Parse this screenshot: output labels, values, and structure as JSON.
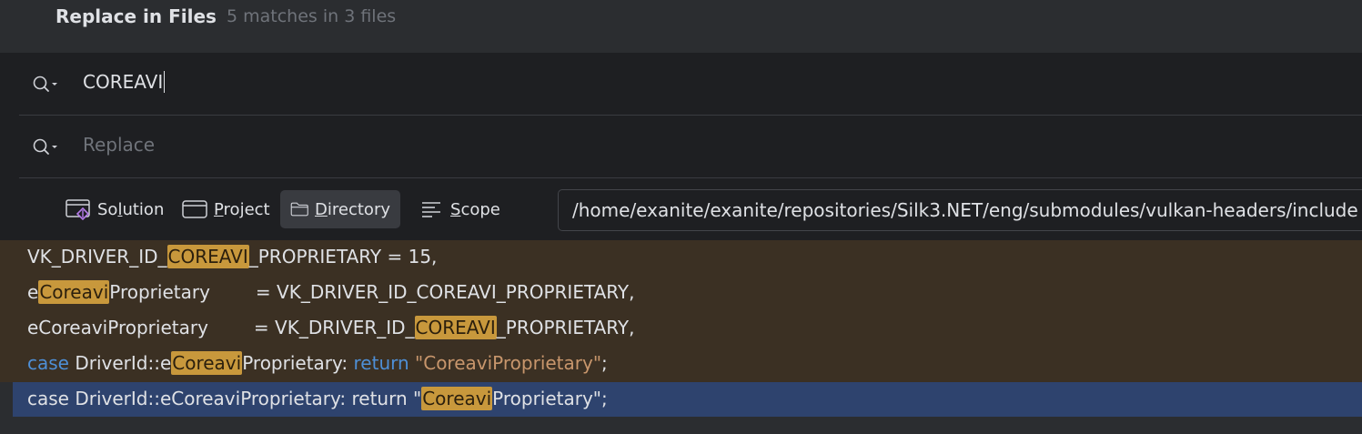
{
  "header": {
    "title": "Replace in Files",
    "match_summary": "5 matches in 3 files"
  },
  "find": {
    "value": "COREAVI"
  },
  "replace": {
    "placeholder": "Replace"
  },
  "scope_tabs": [
    {
      "label_pre": "So",
      "label_u": "l",
      "label_post": "ution",
      "icon": "solution-icon",
      "active": false
    },
    {
      "label_pre": "",
      "label_u": "P",
      "label_post": "roject",
      "icon": "project-icon",
      "active": false
    },
    {
      "label_pre": "",
      "label_u": "D",
      "label_post": "irectory",
      "icon": "folder-icon",
      "active": true
    },
    {
      "label_pre": "",
      "label_u": "S",
      "label_post": "cope",
      "icon": "scope-icon",
      "active": false
    }
  ],
  "directory_path": "/home/exanite/exanite/repositories/Silk3.NET/eng/submodules/vulkan-headers/include",
  "results": [
    {
      "before": "VK_DRIVER_ID_",
      "match": "COREAVI",
      "after": "_PROPRIETARY = ",
      "num": "15",
      "tail": ","
    },
    {
      "before": "e",
      "match": "Coreavi",
      "after": "Proprietary",
      "rhs": "= VK_DRIVER_ID_COREAVI_PROPRIETARY,"
    },
    {
      "before": "eCoreaviProprietary",
      "rhs_pre": "= VK_DRIVER_ID_",
      "match": "COREAVI",
      "after": "_PROPRIETARY,"
    },
    {
      "kw1": "case",
      "mid1": " DriverId::e",
      "match": "Coreavi",
      "mid2": "Proprietary: ",
      "kw2": "return",
      "str": " \"CoreaviProprietary\"",
      "tail": ";"
    },
    {
      "before": "case DriverId::eCoreaviProprietary: return \"",
      "match": "Coreavi",
      "after": "Proprietary\";"
    }
  ]
}
